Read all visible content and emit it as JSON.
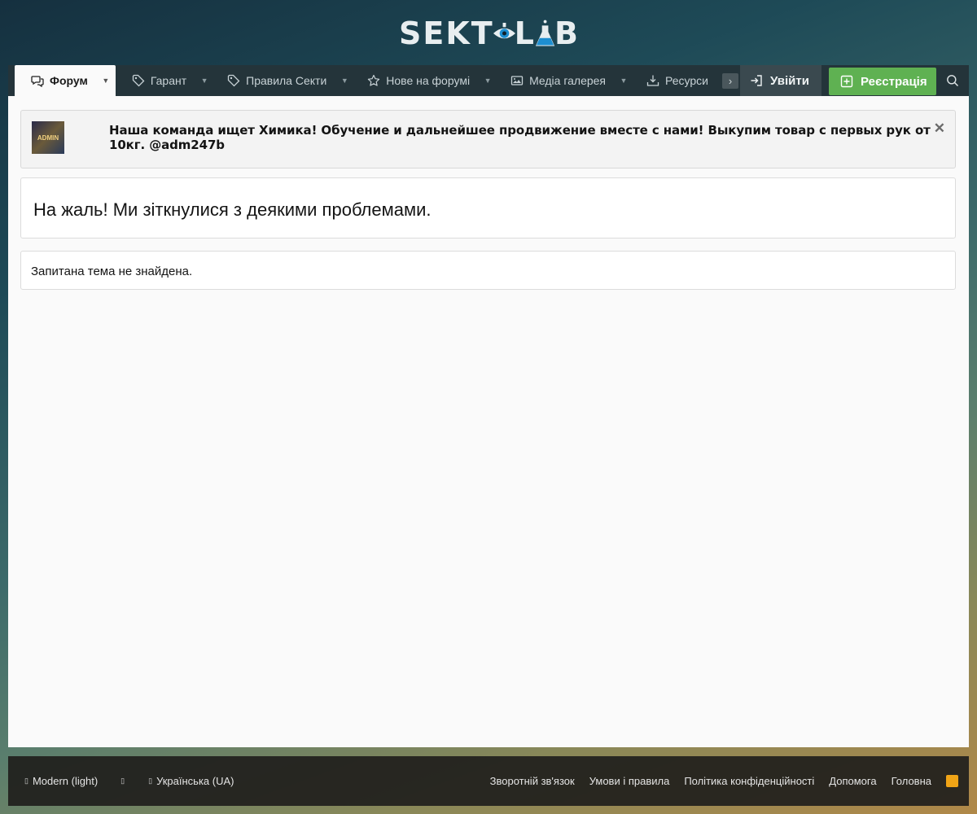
{
  "logo": {
    "text_left": "SEKT",
    "text_right": "B"
  },
  "nav": {
    "tabs": [
      {
        "label": "Форум",
        "icon": "forum-icon"
      },
      {
        "label": "Гарант",
        "icon": "tag-icon"
      },
      {
        "label": "Правила Секти",
        "icon": "tag-icon"
      },
      {
        "label": "Нове на форумі",
        "icon": "star-icon"
      },
      {
        "label": "Медіа галерея",
        "icon": "image-icon"
      },
      {
        "label": "Ресурси",
        "icon": "download-icon"
      }
    ],
    "login_label": "Увійти",
    "register_label": "Реєстрація"
  },
  "notice": {
    "text": "Наша команда ищет Химика! Обучение и дальнейшее продвижение вместе с нами! Выкупим товар с первых рук от 10кг. @adm247b",
    "avatar_text": "ADMIN",
    "close": "✕"
  },
  "error": {
    "title": "На жаль! Ми зіткнулися з деякими проблемами.",
    "message": "Запитана тема не знайдена."
  },
  "footer": {
    "style": "Modern (light)",
    "language": "Українська (UA)",
    "links": [
      "Зворотній зв'язок",
      "Умови і правила",
      "Політика конфіденційності",
      "Допомога",
      "Головна"
    ]
  }
}
